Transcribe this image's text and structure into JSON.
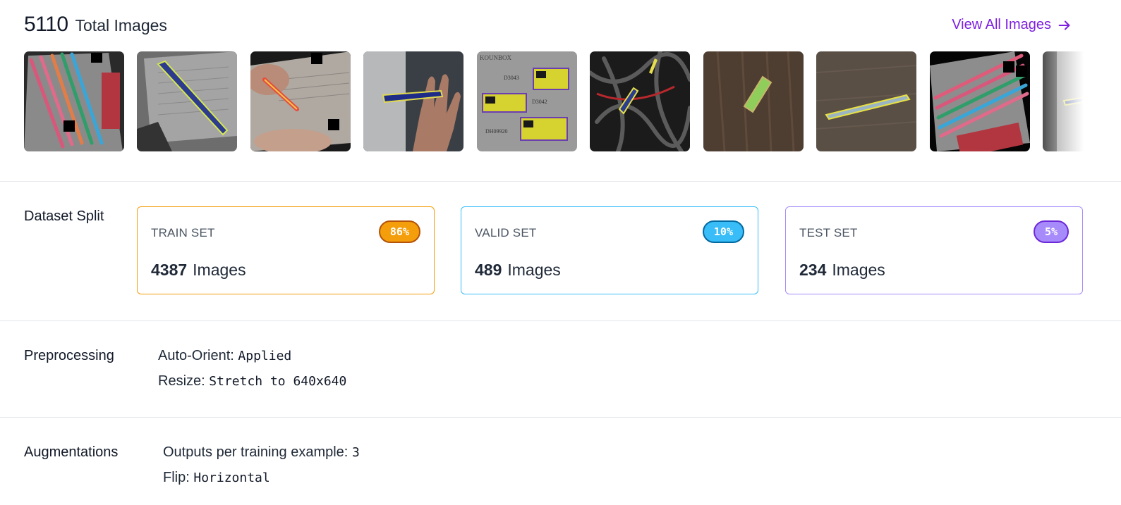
{
  "header": {
    "total_count": "5110",
    "total_label": "Total Images",
    "view_all_label": "View All Images"
  },
  "thumbnails": [
    {
      "alt": "pencils-on-card"
    },
    {
      "alt": "pen-on-paper"
    },
    {
      "alt": "hand-with-pen"
    },
    {
      "alt": "hand-holding-pen"
    },
    {
      "alt": "exam-pen-boxes"
    },
    {
      "alt": "pens-in-wires"
    },
    {
      "alt": "eraser-on-wood"
    },
    {
      "alt": "pen-on-wood"
    },
    {
      "alt": "colored-pencils"
    },
    {
      "alt": "partial-thumbnail"
    }
  ],
  "split": {
    "section_label": "Dataset Split",
    "cards": [
      {
        "title": "TRAIN SET",
        "percent": "86%",
        "count": "4387",
        "unit": "Images",
        "color": "#f59e0b",
        "badge_border": "#b45309"
      },
      {
        "title": "VALID SET",
        "percent": "10%",
        "count": "489",
        "unit": "Images",
        "color": "#38bdf8",
        "badge_border": "#0369a1"
      },
      {
        "title": "TEST SET",
        "percent": "5%",
        "count": "234",
        "unit": "Images",
        "color": "#a78bfa",
        "badge_border": "#6d28d9"
      }
    ]
  },
  "preprocessing": {
    "section_label": "Preprocessing",
    "items": [
      {
        "key": "Auto-Orient:",
        "value": "Applied"
      },
      {
        "key": "Resize:",
        "value": "Stretch to 640x640"
      }
    ]
  },
  "augmentations": {
    "section_label": "Augmentations",
    "items": [
      {
        "key": "Outputs per training example:",
        "value": "3"
      },
      {
        "key": "Flip:",
        "value": "Horizontal"
      }
    ]
  }
}
